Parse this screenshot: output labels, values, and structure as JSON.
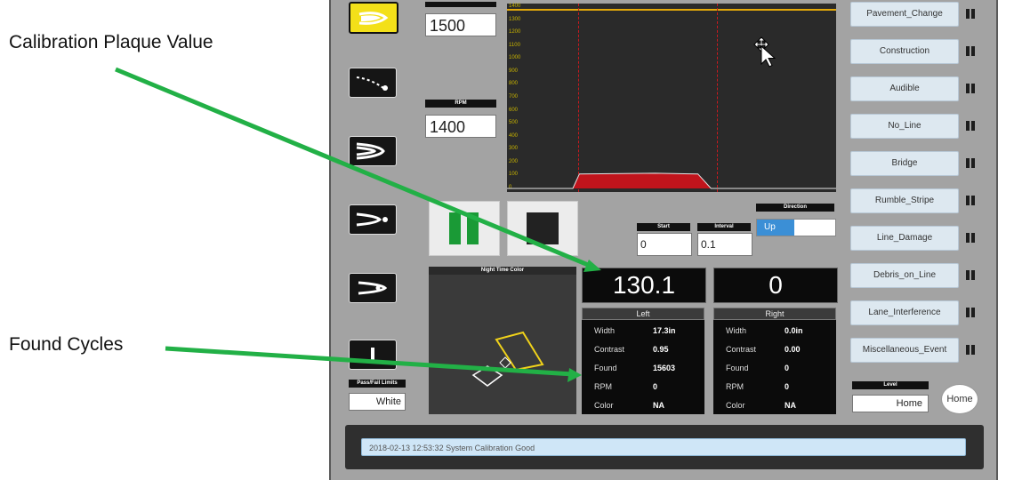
{
  "callouts": {
    "calibration_label": "Calibration Plaque Value",
    "found_label": "Found Cycles"
  },
  "left_panel": {
    "rpm_label": "RPM",
    "speed_value": "1500",
    "rpm_value": "1400",
    "pass_fail_label": "Pass/Fail Limits",
    "pass_fail_value": "White"
  },
  "chart_data": {
    "type": "line",
    "y_ticks": [
      "1400",
      "1300",
      "1200",
      "1100",
      "1000",
      "900",
      "800",
      "700",
      "600",
      "500",
      "400",
      "300",
      "200",
      "100",
      "0"
    ],
    "ylim": [
      0,
      1400
    ],
    "grid": false,
    "threshold_line_color": "#e3a80a",
    "signal_color": "#c0141c",
    "series": [
      {
        "x": [
          0,
          0.2,
          0.22,
          0.45,
          0.58,
          0.62,
          1.0
        ],
        "values": [
          0,
          0,
          110,
          115,
          110,
          0,
          0
        ]
      }
    ]
  },
  "controls": {
    "start_label": "Start",
    "start_value": "0",
    "interval_label": "Interval",
    "interval_value": "0.1",
    "direction_label": "Direction",
    "direction_value": "Up"
  },
  "night_color": {
    "title": "Night Time Color"
  },
  "readouts": {
    "left_value": "130.1",
    "right_value": "0"
  },
  "left_table": {
    "header": "Left",
    "rows": [
      {
        "k": "Width",
        "v": "17.3in"
      },
      {
        "k": "Contrast",
        "v": "0.95"
      },
      {
        "k": "Found",
        "v": "15603"
      },
      {
        "k": "RPM",
        "v": "0"
      },
      {
        "k": "Color",
        "v": "NA"
      }
    ]
  },
  "right_table": {
    "header": "Right",
    "rows": [
      {
        "k": "Width",
        "v": "0.0in"
      },
      {
        "k": "Contrast",
        "v": "0.00"
      },
      {
        "k": "Found",
        "v": "0"
      },
      {
        "k": "RPM",
        "v": "0"
      },
      {
        "k": "Color",
        "v": "NA"
      }
    ]
  },
  "event_buttons": [
    "Pavement_Change",
    "Construction",
    "Audible",
    "No_Line",
    "Bridge",
    "Rumble_Stripe",
    "Line_Damage",
    "Debris_on_Line",
    "Lane_Interference",
    "Miscellaneous_Event"
  ],
  "level": {
    "label": "Level",
    "value": "Home",
    "home_button": "Home"
  },
  "status": {
    "message": "2018-02-13 12:53:32 System Calibration Good"
  }
}
